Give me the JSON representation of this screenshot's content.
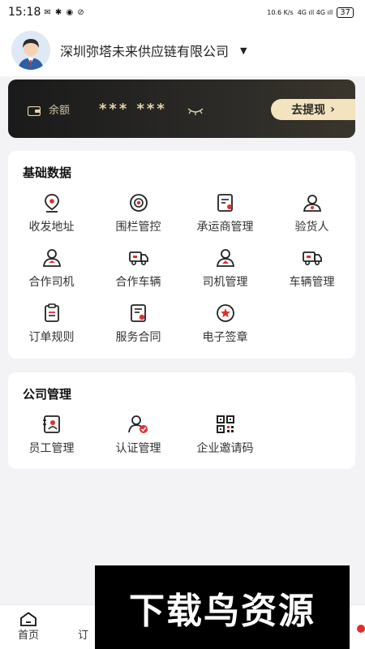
{
  "status_bar": {
    "time": "15:18",
    "left_icons": "✉ ✱ ◉ ⊘",
    "net_speed": "10.6 K/s",
    "signal": "4G ıll 4G ıll",
    "battery": "37"
  },
  "header": {
    "company_name": "深圳弥塔未来供应链有限公司",
    "dropdown_icon": "caret-down"
  },
  "balance_card": {
    "label": "余额",
    "masked_value": "*** ***",
    "withdraw_label": "去提现"
  },
  "basic_data": {
    "title": "基础数据",
    "items": [
      {
        "label": "收发地址",
        "icon": "location-pin-icon"
      },
      {
        "label": "围栏管控",
        "icon": "fence-target-icon"
      },
      {
        "label": "承运商管理",
        "icon": "carrier-document-icon"
      },
      {
        "label": "验货人",
        "icon": "inspector-user-icon"
      },
      {
        "label": "合作司机",
        "icon": "driver-icon"
      },
      {
        "label": "合作车辆",
        "icon": "truck-icon"
      },
      {
        "label": "司机管理",
        "icon": "driver-manage-icon"
      },
      {
        "label": "车辆管理",
        "icon": "vehicle-manage-icon"
      },
      {
        "label": "订单规则",
        "icon": "clipboard-icon"
      },
      {
        "label": "服务合同",
        "icon": "contract-icon"
      },
      {
        "label": "电子签章",
        "icon": "seal-star-icon"
      }
    ]
  },
  "company_mgmt": {
    "title": "公司管理",
    "items": [
      {
        "label": "员工管理",
        "icon": "employee-card-icon"
      },
      {
        "label": "认证管理",
        "icon": "certification-icon"
      },
      {
        "label": "企业邀请码",
        "icon": "qrcode-icon"
      }
    ]
  },
  "bottom_nav": {
    "home_label": "首页",
    "order_label": "订"
  },
  "watermark": {
    "text": "下载鸟资源"
  },
  "colors": {
    "card_dark": "#1a1a1a",
    "gold": "#e8d2a5",
    "accent_red": "#e0302b"
  }
}
